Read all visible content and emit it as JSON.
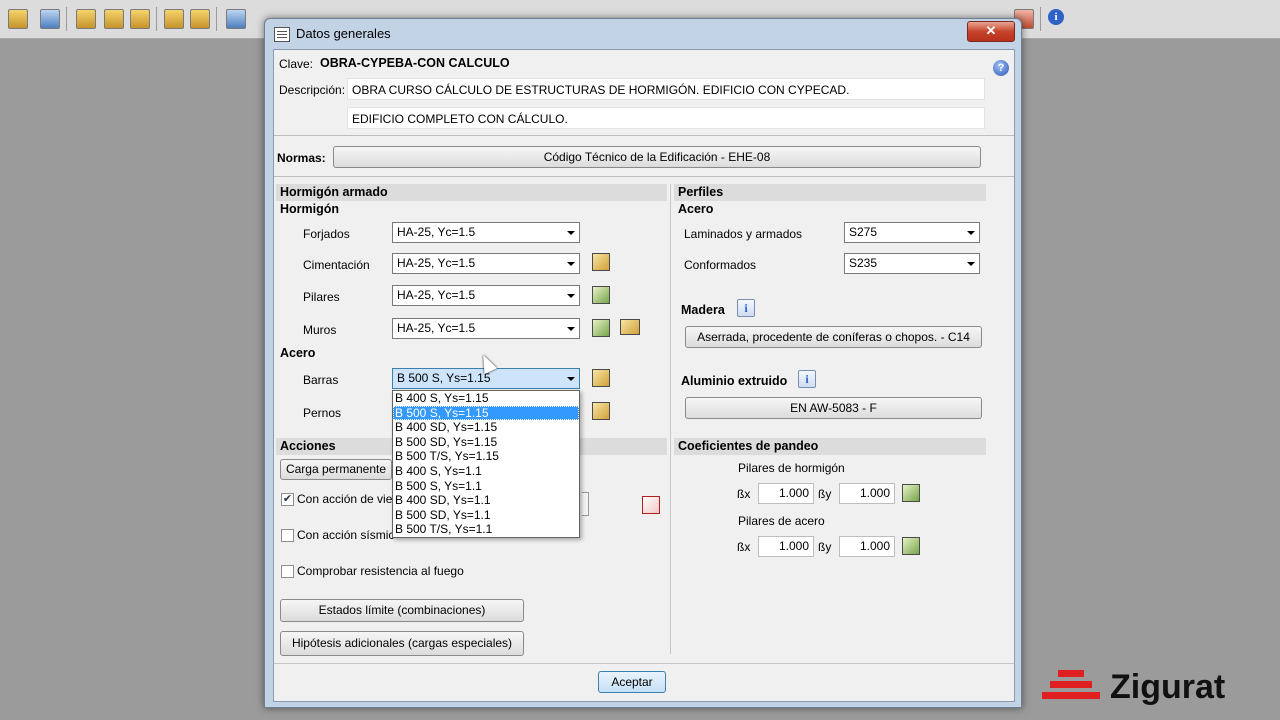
{
  "dialog": {
    "title": "Datos generales",
    "close_label": "✕",
    "clave_label": "Clave:",
    "clave_value": "OBRA-CYPEBA-CON CALCULO",
    "descripcion_label": "Descripción:",
    "descripcion_line1": "OBRA CURSO CÁLCULO DE ESTRUCTURAS DE HORMIGÓN. EDIFICIO CON CYPECAD.",
    "descripcion_line2": "EDIFICIO COMPLETO CON CÁLCULO.",
    "help_label": "?",
    "normas_label": "Normas:",
    "normas_value": "Código Técnico de la Edificación - EHE-08",
    "accept_label": "Aceptar"
  },
  "hormigon_armado": {
    "section_title": "Hormigón armado",
    "hormigon_title": "Hormigón",
    "forjados_label": "Forjados",
    "forjados_value": "HA-25, Yc=1.5",
    "cimentacion_label": "Cimentación",
    "cimentacion_value": "HA-25, Yc=1.5",
    "pilares_label": "Pilares",
    "pilares_value": "HA-25, Yc=1.5",
    "muros_label": "Muros",
    "muros_value": "HA-25, Yc=1.5",
    "acero_title": "Acero",
    "barras_label": "Barras",
    "barras_value": "B 500 S, Ys=1.15",
    "pernos_label": "Pernos",
    "dropdown_options": [
      "B 400 S, Ys=1.15",
      "B 500 S, Ys=1.15",
      "B 400 SD, Ys=1.15",
      "B 500 SD, Ys=1.15",
      "B 500 T/S, Ys=1.15",
      "B 400 S, Ys=1.1",
      "B 500 S, Ys=1.1",
      "B 400 SD, Ys=1.1",
      "B 500 SD, Ys=1.1",
      "B 500 T/S, Ys=1.1"
    ],
    "dropdown_selected_index": 1
  },
  "perfiles": {
    "section_title": "Perfiles",
    "acero_title": "Acero",
    "laminados_label": "Laminados y armados",
    "laminados_value": "S275",
    "conformados_label": "Conformados",
    "conformados_value": "S235",
    "madera_label": "Madera",
    "madera_value": "Aserrada, procedente de coníferas o chopos. - C14",
    "aluminio_label": "Aluminio extruido",
    "aluminio_value": "EN AW-5083 - F"
  },
  "acciones": {
    "section_title": "Acciones",
    "carga_button": "Carga permanente",
    "viento_label": "Con acción de vie",
    "viento_checked": true,
    "sismica_label": "Con acción sísmic",
    "sismica_checked": false,
    "fuego_label": "Comprobar resistencia al fuego",
    "fuego_checked": false,
    "estados_button": "Estados límite (combinaciones)",
    "hipotesis_button": "Hipótesis adicionales (cargas especiales)"
  },
  "pandeo": {
    "section_title": "Coeficientes de pandeo",
    "hormigon_label": "Pilares de hormigón",
    "acero_label": "Pilares de acero",
    "bx_label": "ßx",
    "by_label": "ßy",
    "hormigon_bx": "1.000",
    "hormigon_by": "1.000",
    "acero_bx": "1.000",
    "acero_by": "1.000"
  },
  "brand": {
    "name": "Zigurat",
    "color": "#e02020"
  },
  "icons": [
    "toolbar-tool-icon",
    "info-icon",
    "edit-icon",
    "library-icon",
    "table-icon"
  ]
}
